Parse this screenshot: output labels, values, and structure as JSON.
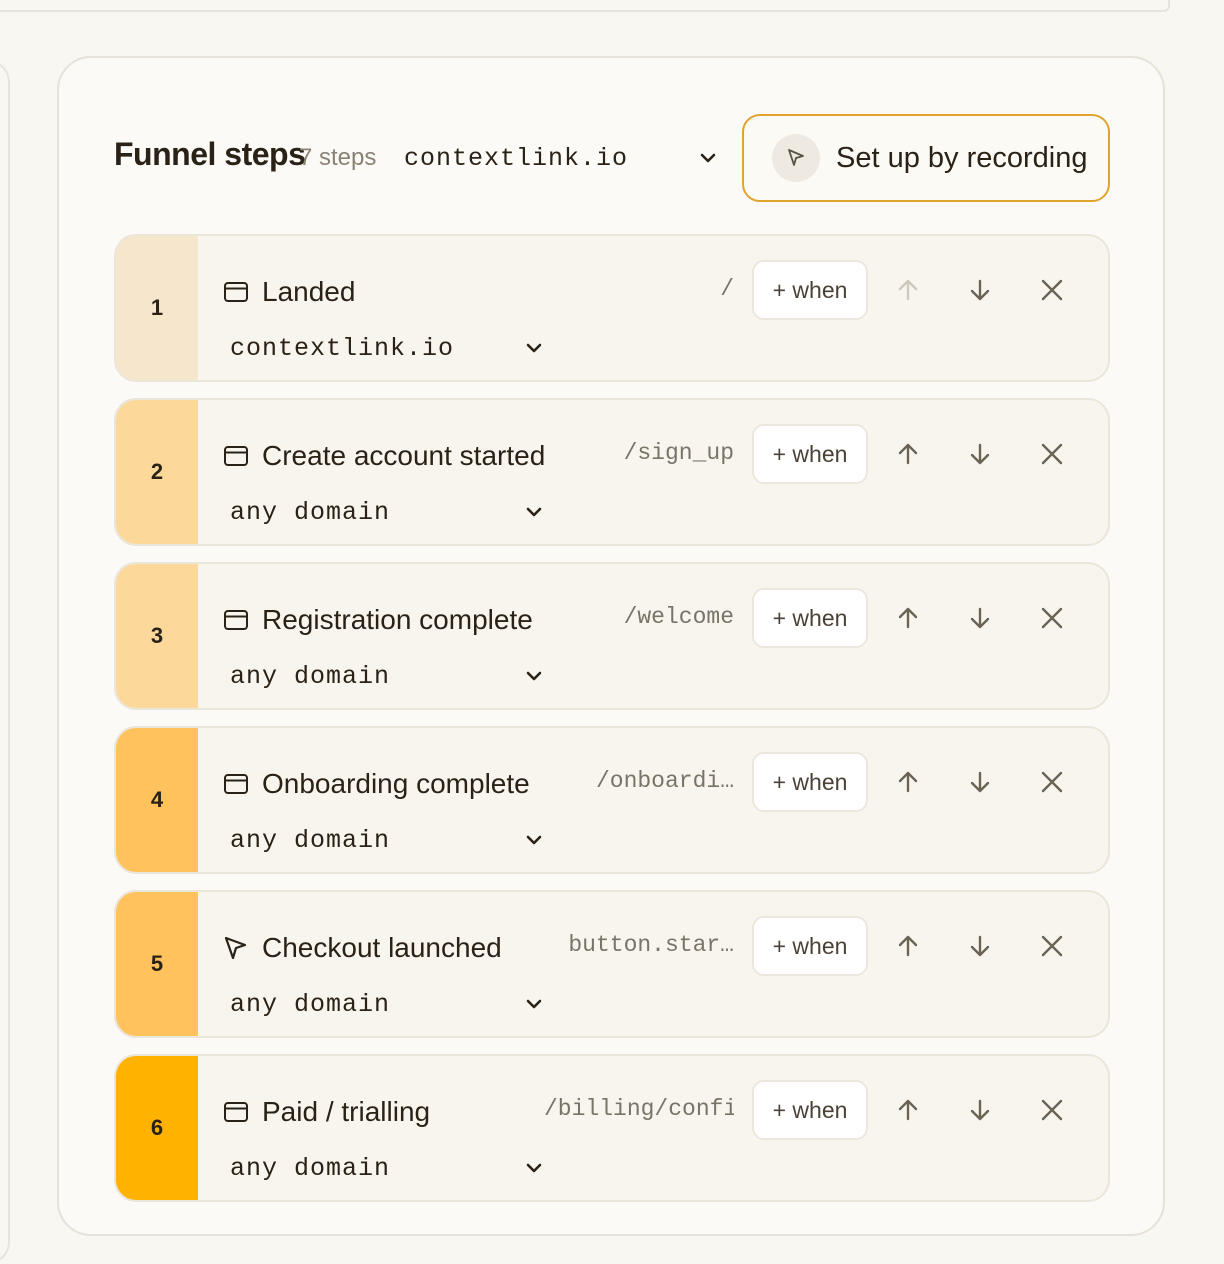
{
  "header": {
    "title": "Funnel steps",
    "step_count": "7 steps",
    "domain": "contextlink.io",
    "record_button": "Set up by recording"
  },
  "steps": [
    {
      "number": "1",
      "name": "Landed",
      "type_icon": "window-icon",
      "path": "/",
      "when_label": "+ when",
      "domain": "contextlink.io",
      "color": "#f6e6cc",
      "up_enabled": false
    },
    {
      "number": "2",
      "name": "Create account started",
      "type_icon": "window-icon",
      "path": "/sign_up",
      "when_label": "+ when",
      "domain": "any domain",
      "color": "#fcd89a",
      "up_enabled": true
    },
    {
      "number": "3",
      "name": "Registration complete",
      "type_icon": "window-icon",
      "path": "/welcome",
      "when_label": "+ when",
      "domain": "any domain",
      "color": "#fcd89a",
      "up_enabled": true
    },
    {
      "number": "4",
      "name": "Onboarding complete",
      "type_icon": "window-icon",
      "path": "/onboardi…",
      "when_label": "+ when",
      "domain": "any domain",
      "color": "#ffc25c",
      "up_enabled": true
    },
    {
      "number": "5",
      "name": "Checkout launched",
      "type_icon": "cursor-icon",
      "path": "button.star…",
      "when_label": "+ when",
      "domain": "any domain",
      "color": "#ffc25c",
      "up_enabled": true
    },
    {
      "number": "6",
      "name": "Paid / trialling",
      "type_icon": "window-icon",
      "path": "/billing/confi…",
      "when_label": "+ when",
      "domain": "any domain",
      "color": "#ffb200",
      "up_enabled": true
    }
  ]
}
